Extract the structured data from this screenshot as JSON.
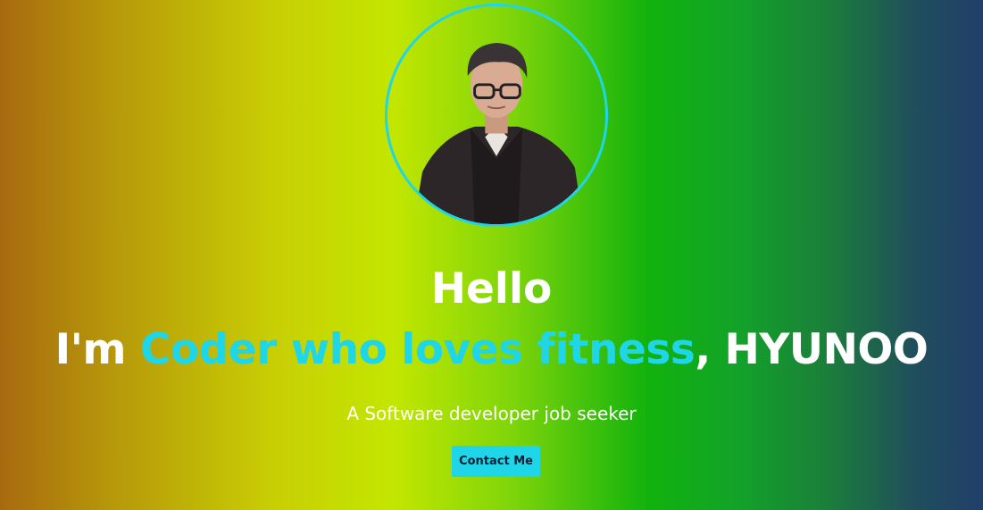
{
  "hero": {
    "greeting": "Hello",
    "intro_prefix": "I'm ",
    "intro_highlight": "Coder who loves fitness",
    "intro_suffix": ", HYUNOO",
    "tagline": "A Software developer job seeker",
    "contact_label": "Contact Me"
  },
  "colors": {
    "accent": "#1fd6e8",
    "text": "#ffffff",
    "button_text": "#0c1f33"
  },
  "icons": {
    "avatar": "profile-photo"
  }
}
